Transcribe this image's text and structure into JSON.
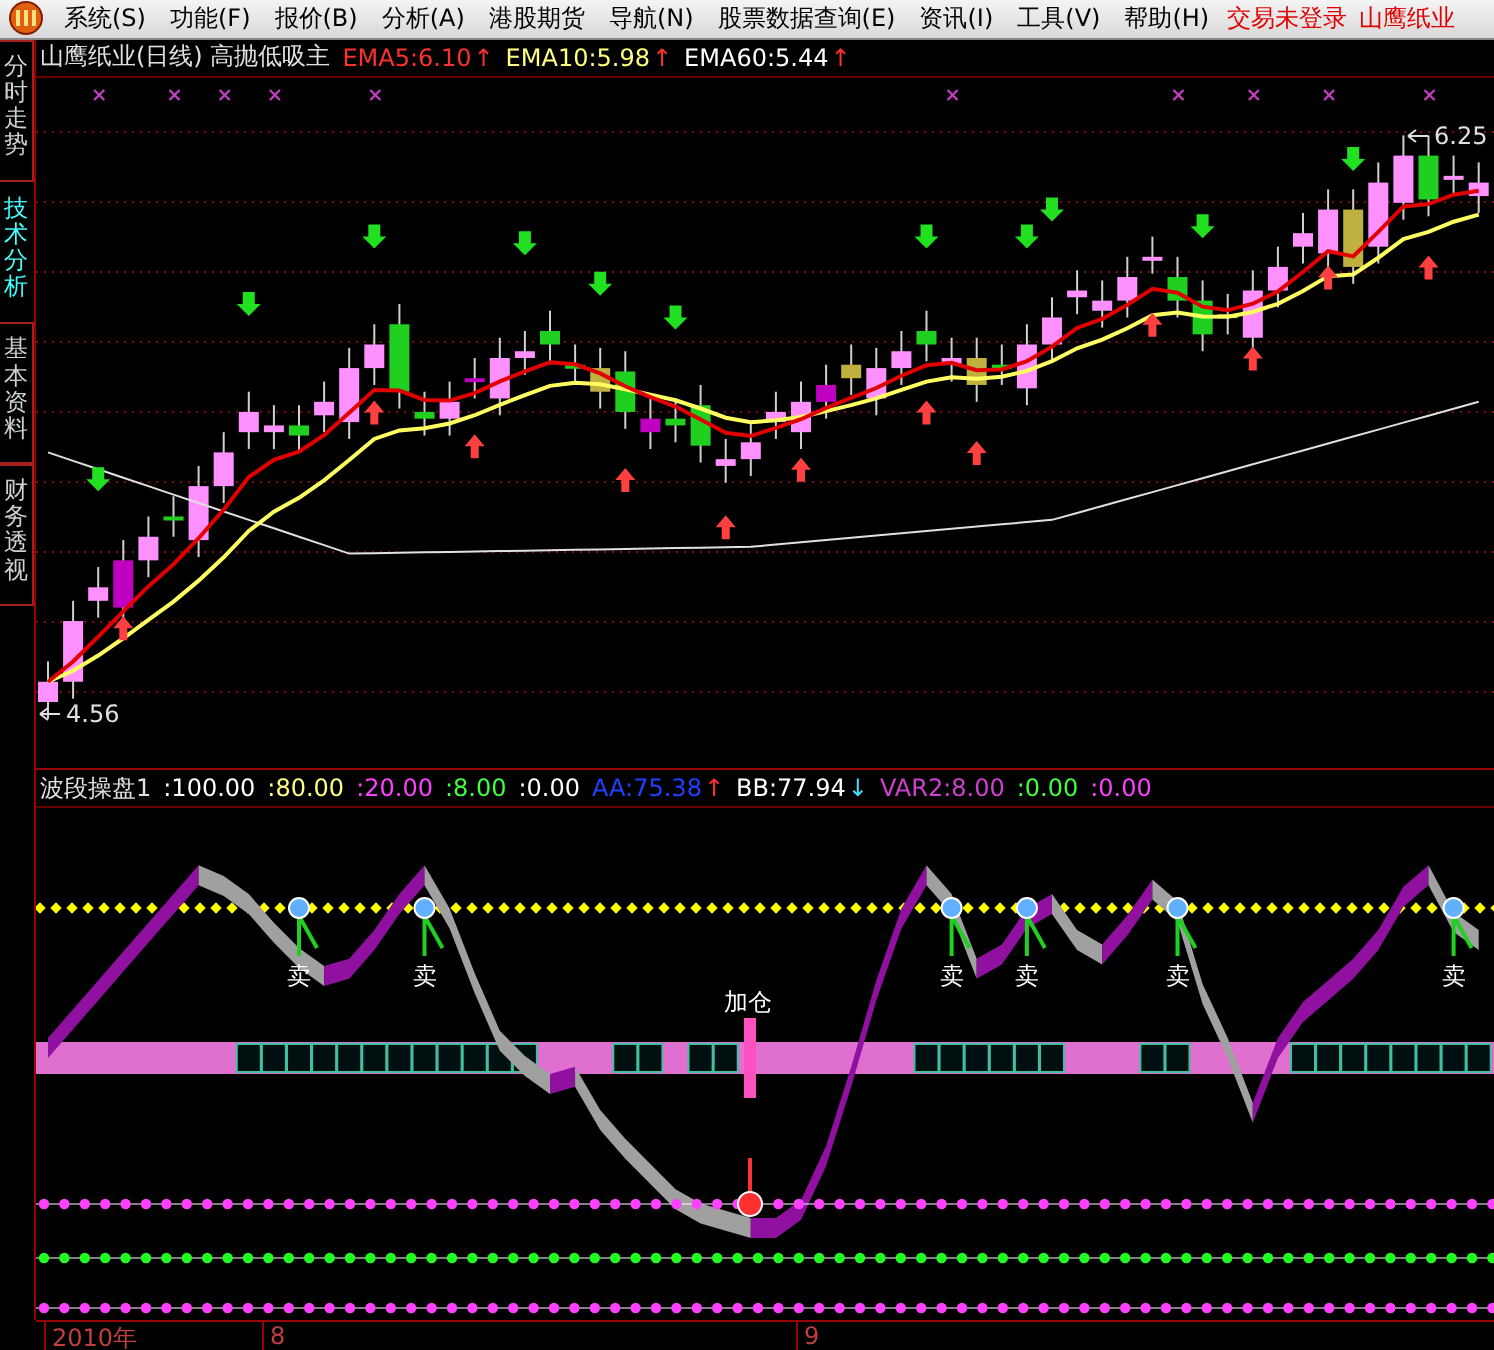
{
  "menu": {
    "items": [
      "系统(S)",
      "功能(F)",
      "报价(B)",
      "分析(A)",
      "港股期货",
      "导航(N)",
      "股票数据查询(E)",
      "资讯(I)",
      "工具(V)",
      "帮助(H)"
    ],
    "status": "交易未登录",
    "stock": "山鹰纸业"
  },
  "side_tabs": [
    {
      "label": "分时走势",
      "selected": false
    },
    {
      "label": "技术分析",
      "selected": true
    },
    {
      "label": "基本资料",
      "selected": false
    },
    {
      "label": "财务透视",
      "selected": false
    }
  ],
  "main_chart": {
    "title": "山鹰纸业(日线) 高抛低吸主",
    "indicators": [
      {
        "label": "EMA5:6.10",
        "color": "#ff3030",
        "arrow": {
          "symbol": "↑",
          "color": "#ff3030"
        }
      },
      {
        "label": "EMA10:5.98",
        "color": "#ffff80",
        "arrow": {
          "symbol": "↑",
          "color": "#ff3030"
        }
      },
      {
        "label": "EMA60:5.44",
        "color": "#ffffff",
        "arrow": {
          "symbol": "↑",
          "color": "#ff3030"
        }
      }
    ],
    "high_label": "6.25",
    "low_label": "4.56"
  },
  "sub_chart": {
    "title": "波段操盘1",
    "values": [
      {
        "label": ":100.00",
        "color": "#ffffff"
      },
      {
        "label": ":80.00",
        "color": "#ffff80"
      },
      {
        "label": ":20.00",
        "color": "#ff40ff"
      },
      {
        "label": ":8.00",
        "color": "#40ff40"
      },
      {
        "label": ":0.00",
        "color": "#ffffff"
      },
      {
        "label": "AA:75.38",
        "color": "#2040ff",
        "arrow": {
          "symbol": "↑",
          "color": "#ff3030"
        }
      },
      {
        "label": "BB:77.94",
        "color": "#ffffff",
        "arrow": {
          "symbol": "↓",
          "color": "#40e0ff"
        }
      },
      {
        "label": "VAR2:8.00",
        "color": "#d040d0"
      },
      {
        "label": ":0.00",
        "color": "#40ff40"
      },
      {
        "label": ":0.00",
        "color": "#ff40ff"
      }
    ],
    "sell_labels": [
      "卖",
      "卖",
      "卖",
      "卖",
      "卖",
      "卖"
    ],
    "add_label": "加仓"
  },
  "axis": {
    "labels": [
      "2010年",
      "8",
      "9"
    ]
  }
}
